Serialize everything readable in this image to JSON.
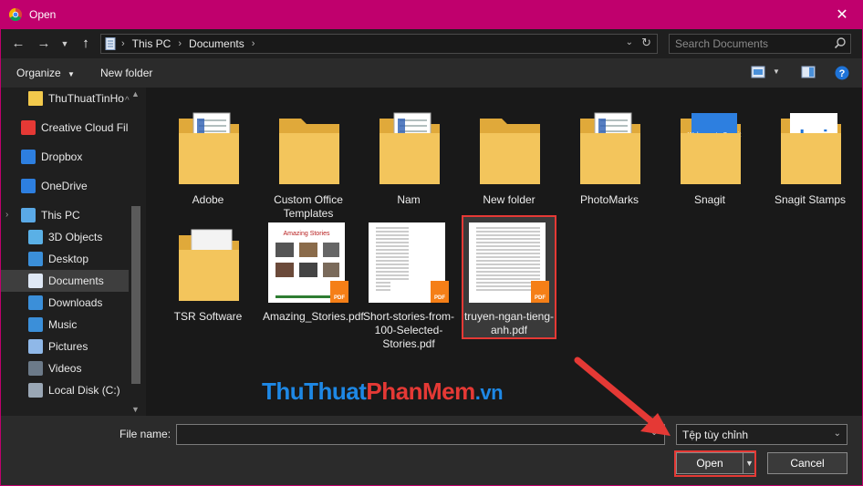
{
  "window": {
    "title": "Open",
    "close_glyph": "✕"
  },
  "address": {
    "crumbs": [
      "This PC",
      "Documents"
    ],
    "search_placeholder": "Search Documents"
  },
  "toolbar": {
    "organize": "Organize",
    "new_folder": "New folder"
  },
  "nav": {
    "items": [
      {
        "label": "ThuThuatTinHo",
        "icon": "folder-icon"
      },
      {
        "label": "Creative Cloud Fil",
        "icon": "creative-cloud-icon"
      },
      {
        "label": "Dropbox",
        "icon": "dropbox-icon"
      },
      {
        "label": "OneDrive",
        "icon": "onedrive-icon"
      },
      {
        "label": "This PC",
        "icon": "computer-icon"
      },
      {
        "label": "3D Objects",
        "icon": "3d-objects-icon"
      },
      {
        "label": "Desktop",
        "icon": "desktop-icon"
      },
      {
        "label": "Documents",
        "icon": "documents-icon"
      },
      {
        "label": "Downloads",
        "icon": "downloads-icon"
      },
      {
        "label": "Music",
        "icon": "music-icon"
      },
      {
        "label": "Pictures",
        "icon": "pictures-icon"
      },
      {
        "label": "Videos",
        "icon": "videos-icon"
      },
      {
        "label": "Local Disk (C:)",
        "icon": "drive-icon"
      }
    ]
  },
  "files": [
    {
      "label": "Adobe",
      "kind": "folder-docs"
    },
    {
      "label": "Custom Office Templates",
      "kind": "folder"
    },
    {
      "label": "Nam",
      "kind": "folder-docs"
    },
    {
      "label": "New folder",
      "kind": "folder"
    },
    {
      "label": "PhotoMarks",
      "kind": "folder-docs"
    },
    {
      "label": "Snagit",
      "kind": "folder-snagit"
    },
    {
      "label": "Snagit Stamps",
      "kind": "folder-stamps"
    },
    {
      "label": "TSR Software",
      "kind": "folder-white"
    },
    {
      "label": "Amazing_Stories.pdf",
      "kind": "pdf",
      "preview_title": "Amazing Stories"
    },
    {
      "label": "Short-stories-from-100-Selected-Stories.pdf",
      "kind": "pdf"
    },
    {
      "label": "truyen-ngan-tieng-anh.pdf",
      "kind": "pdf"
    }
  ],
  "bottom": {
    "filename_label": "File name:",
    "filename_value": "",
    "filetype": "Tệp tùy chỉnh",
    "open_label": "Open",
    "cancel_label": "Cancel"
  },
  "watermark": {
    "part1": "Thu",
    "part2": "Thuat",
    "part3": "Phan",
    "part4": "Mem",
    "part5": ".vn"
  },
  "colors": {
    "titlebar": "#c0006d",
    "highlight": "#e53935",
    "watermark_blue": "#1e88e5",
    "watermark_red": "#e53935"
  }
}
